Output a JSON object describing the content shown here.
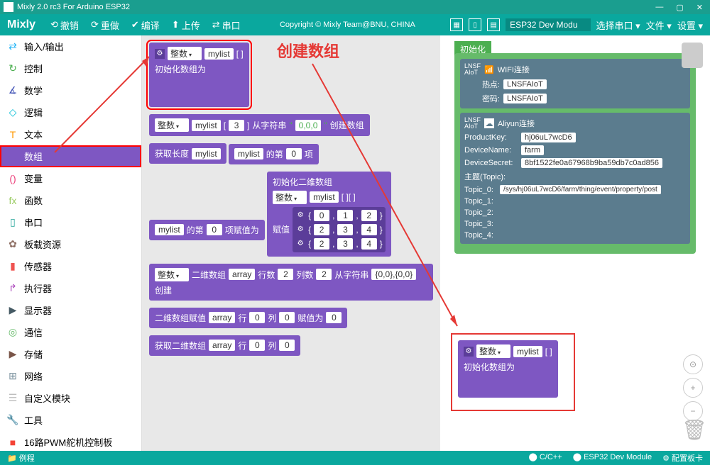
{
  "titlebar": {
    "title": "Mixly 2.0 rc3 For Arduino ESP32"
  },
  "topbar": {
    "logo": "Mixly",
    "menu": {
      "undo": "撤销",
      "redo": "重做",
      "compile": "编译",
      "upload": "上传",
      "serial": "串口"
    },
    "copyright": "Copyright © Mixly Team@BNU, CHINA",
    "board": "ESP32 Dev Modu",
    "port": "选择串口",
    "file": "文件",
    "settings": "设置"
  },
  "sidebar": {
    "items": [
      {
        "name": "io",
        "label": "输入/输出",
        "color": "#29b6f6",
        "glyph": "⇄"
      },
      {
        "name": "control",
        "label": "控制",
        "color": "#4caf50",
        "glyph": "↻"
      },
      {
        "name": "math",
        "label": "数学",
        "color": "#3f51b5",
        "glyph": "∡"
      },
      {
        "name": "logic",
        "label": "逻辑",
        "color": "#00bcd4",
        "glyph": "◇"
      },
      {
        "name": "text",
        "label": "文本",
        "color": "#ff9800",
        "glyph": "T"
      },
      {
        "name": "array",
        "label": "数组",
        "color": "#7e57c2",
        "glyph": "≡"
      },
      {
        "name": "variable",
        "label": "变量",
        "color": "#ec407a",
        "glyph": "()"
      },
      {
        "name": "function",
        "label": "函数",
        "color": "#9ccc65",
        "glyph": "fx"
      },
      {
        "name": "serial",
        "label": "串口",
        "color": "#26a69a",
        "glyph": "▯"
      },
      {
        "name": "resource",
        "label": "板载资源",
        "color": "#8d6e63",
        "glyph": "✿"
      },
      {
        "name": "sensor",
        "label": "传感器",
        "color": "#ef5350",
        "glyph": "▮"
      },
      {
        "name": "actuator",
        "label": "执行器",
        "color": "#ab47bc",
        "glyph": "↱"
      },
      {
        "name": "display",
        "label": "显示器",
        "color": "#455a64",
        "glyph": "▶"
      },
      {
        "name": "comm",
        "label": "通信",
        "color": "#66bb6a",
        "glyph": "◎"
      },
      {
        "name": "storage",
        "label": "存储",
        "color": "#795548",
        "glyph": "▶"
      },
      {
        "name": "network",
        "label": "网络",
        "color": "#78909c",
        "glyph": "⊞"
      },
      {
        "name": "custom",
        "label": "自定义模块",
        "color": "#bdbdbd",
        "glyph": "☰"
      },
      {
        "name": "tools",
        "label": "工具",
        "color": "#ffa726",
        "glyph": "🔧"
      },
      {
        "name": "servo",
        "label": "16路PWM舵机控制板",
        "color": "#f44336",
        "glyph": "■"
      }
    ]
  },
  "palette": {
    "block1": {
      "type": "整数",
      "name": "mylist",
      "brackets": "[  ]",
      "init": "初始化数组为"
    },
    "block2": {
      "type": "整数",
      "name": "mylist",
      "size": "3",
      "from": "从字符串",
      "str": "0,0,0",
      "create": "创建数组"
    },
    "block3": {
      "label": "获取长度",
      "name": "mylist"
    },
    "block4": {
      "name": "mylist",
      "de": "的第",
      "idx": "0",
      "xiang": "项"
    },
    "block5": {
      "name": "mylist",
      "de": "的第",
      "idx": "0",
      "assign": "项赋值为"
    },
    "block6": {
      "title": "初始化二维数组",
      "type": "整数",
      "name": "mylist",
      "brackets": "[ ][ ]",
      "assign": "赋值",
      "m": [
        [
          "0",
          "1",
          "2"
        ],
        [
          "2",
          "3",
          "4"
        ],
        [
          "2",
          "3",
          "4"
        ]
      ]
    },
    "block7": {
      "type": "整数",
      "d2": "二维数组",
      "arr": "array",
      "rows": "行数",
      "r": "2",
      "cols": "列数",
      "c": "2",
      "from": "从字符串",
      "str": "{0,0},{0,0}",
      "create": "创建"
    },
    "block8": {
      "label": "二维数组赋值",
      "arr": "array",
      "row": "行",
      "r": "0",
      "col": "列",
      "c": "0",
      "assign": "赋值为",
      "v": "0"
    },
    "block9": {
      "label": "获取二维数组",
      "arr": "array",
      "row": "行",
      "r": "0",
      "col": "列",
      "c": "0"
    }
  },
  "annotation": {
    "text": "创建数组"
  },
  "workspace": {
    "setup": "初始化",
    "wifi": {
      "lnsf": "LNSF",
      "aiot": "AIoT",
      "conn": "WIFI连接",
      "hotspot": "热点:",
      "hotspot_val": "LNSFAIoT",
      "pwd": "密码:",
      "pwd_val": "LNSFAIoT"
    },
    "aliyun": {
      "lnsf": "LNSF",
      "aiot": "AIoT",
      "conn": "Aliyun连接",
      "pk": "ProductKey:",
      "pk_val": "hj06uL7wcD6",
      "dn": "DeviceName:",
      "dn_val": "farm",
      "ds": "DeviceSecret:",
      "ds_val": "8bf1522fe0a67968b9ba59db7c0ad856",
      "topic": "主题(Topic):",
      "t0": "Topic_0:",
      "t0_val": "/sys/hj06uL7wcD6/farm/thing/event/property/post",
      "t1": "Topic_1:",
      "t2": "Topic_2:",
      "t3": "Topic_3:",
      "t4": "Topic_4:"
    },
    "mylist": {
      "type": "整数",
      "name": "mylist",
      "brackets": "[  ]",
      "init": "初始化数组为"
    }
  },
  "statusbar": {
    "left": "例程",
    "cpp": "C/C++",
    "board": "ESP32 Dev Module",
    "conn": "配置板卡"
  }
}
